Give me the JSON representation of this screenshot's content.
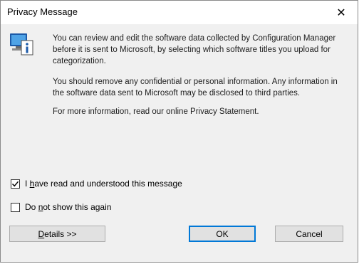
{
  "window": {
    "title": "Privacy Message",
    "close_label": "✕"
  },
  "message": {
    "paragraph1": "You can review and edit the software data collected by Configuration Manager before it is sent to Microsoft, by selecting which software titles you upload for categorization.",
    "paragraph2": "You should remove any confidential or personal information.  Any information in the software data sent to Microsoft may be disclosed to third parties.",
    "paragraph3": "For more information, read our online Privacy Statement."
  },
  "checkboxes": {
    "read_understood": {
      "label_prefix": "I ",
      "label_access": "h",
      "label_rest": "ave read and understood this message",
      "checked": true
    },
    "do_not_show": {
      "label_prefix": "Do ",
      "label_access": "n",
      "label_rest": "ot show this again",
      "checked": false
    }
  },
  "buttons": {
    "details_access": "D",
    "details_rest": "etails >>",
    "ok": "OK",
    "cancel": "Cancel"
  },
  "icon": "computer-info-icon",
  "colors": {
    "accent": "#0078d7",
    "dialog_bg": "#f0f0f0",
    "titlebar_bg": "#ffffff"
  }
}
